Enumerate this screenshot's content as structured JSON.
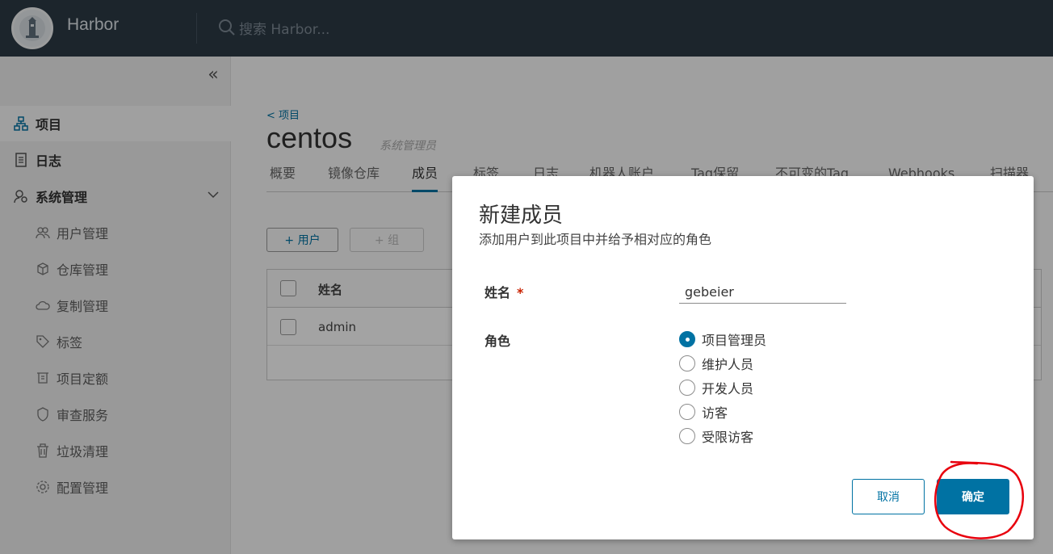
{
  "header": {
    "brand": "Harbor",
    "search_placeholder": "搜索 Harbor..."
  },
  "sidebar": {
    "collapse_glyph": "«",
    "items": [
      {
        "label": "项目",
        "icon": "project-icon",
        "active": true
      },
      {
        "label": "日志",
        "icon": "log-icon"
      },
      {
        "label": "系统管理",
        "icon": "admin-icon",
        "expanded": true
      }
    ],
    "sub_items": [
      {
        "label": "用户管理",
        "icon": "users-icon"
      },
      {
        "label": "仓库管理",
        "icon": "registry-icon"
      },
      {
        "label": "复制管理",
        "icon": "replication-icon"
      },
      {
        "label": "标签",
        "icon": "tag-icon"
      },
      {
        "label": "项目定额",
        "icon": "quota-icon"
      },
      {
        "label": "审查服务",
        "icon": "shield-icon"
      },
      {
        "label": "垃圾清理",
        "icon": "trash-icon"
      },
      {
        "label": "配置管理",
        "icon": "gear-icon"
      }
    ]
  },
  "main": {
    "breadcrumb": "< 项目",
    "project_name": "centos",
    "project_role": "系统管理员",
    "tabs": [
      "概要",
      "镜像仓库",
      "成员",
      "标签",
      "日志",
      "机器人账户",
      "Tag保留",
      "不可变的Tag",
      "Webhooks",
      "扫描器"
    ],
    "active_tab": "成员",
    "add_user_label": "+ 用户",
    "add_group_label": "+ 组",
    "grid": {
      "header_name": "姓名",
      "rows": [
        {
          "name": "admin"
        }
      ]
    }
  },
  "modal": {
    "title": "新建成员",
    "subtitle": "添加用户到此项目中并给予相对应的角色",
    "name_label": "姓名",
    "required_mark": "*",
    "name_value": "gebeier",
    "role_label": "角色",
    "roles": [
      "项目管理员",
      "维护人员",
      "开发人员",
      "访客",
      "受限访客"
    ],
    "selected_role": "项目管理员",
    "cancel_label": "取消",
    "ok_label": "确定"
  },
  "colors": {
    "header_bg": "#2d3a46",
    "primary": "#0072a3",
    "annotation": "#e8000d"
  }
}
